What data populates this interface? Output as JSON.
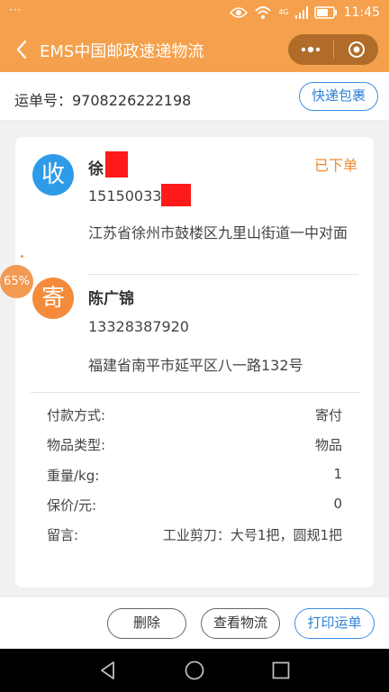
{
  "status_bar": {
    "dots": "···",
    "network_label": "4G",
    "time": "11:45"
  },
  "header": {
    "title": "EMS中国邮政速递物流",
    "capsule": {
      "more_icon": "more-dots-icon",
      "close_icon": "close-target-icon"
    }
  },
  "waybill": {
    "label": "运单号：9708226222198",
    "button": "快递包裹"
  },
  "receiver": {
    "avatar": "收",
    "name": "徐",
    "phone": "15150033",
    "address": "江苏省徐州市鼓楼区九里山街道一中对面"
  },
  "order_status": "已下单",
  "sender": {
    "avatar": "寄",
    "name": "陈广锦",
    "phone": "13328387920",
    "address": "福建省南平市延平区八一路132号"
  },
  "details": [
    {
      "key": "付款方式:",
      "value": "寄付"
    },
    {
      "key": "物品类型:",
      "value": "物品"
    },
    {
      "key": "重量/kg:",
      "value": "1"
    },
    {
      "key": "保价/元:",
      "value": "0"
    },
    {
      "key": "留言:",
      "value": "工业剪刀：大号1把，圆规1把"
    }
  ],
  "progress_badge": "65%",
  "actions": {
    "delete": "删除",
    "track": "查看物流",
    "print": "打印运单"
  },
  "colors": {
    "brand_orange": "#f5a04c",
    "status_orange": "#ef8b2a",
    "link_blue": "#2f80d8",
    "receiver_blue": "#2f9be8",
    "sender_orange": "#f38b3a"
  }
}
